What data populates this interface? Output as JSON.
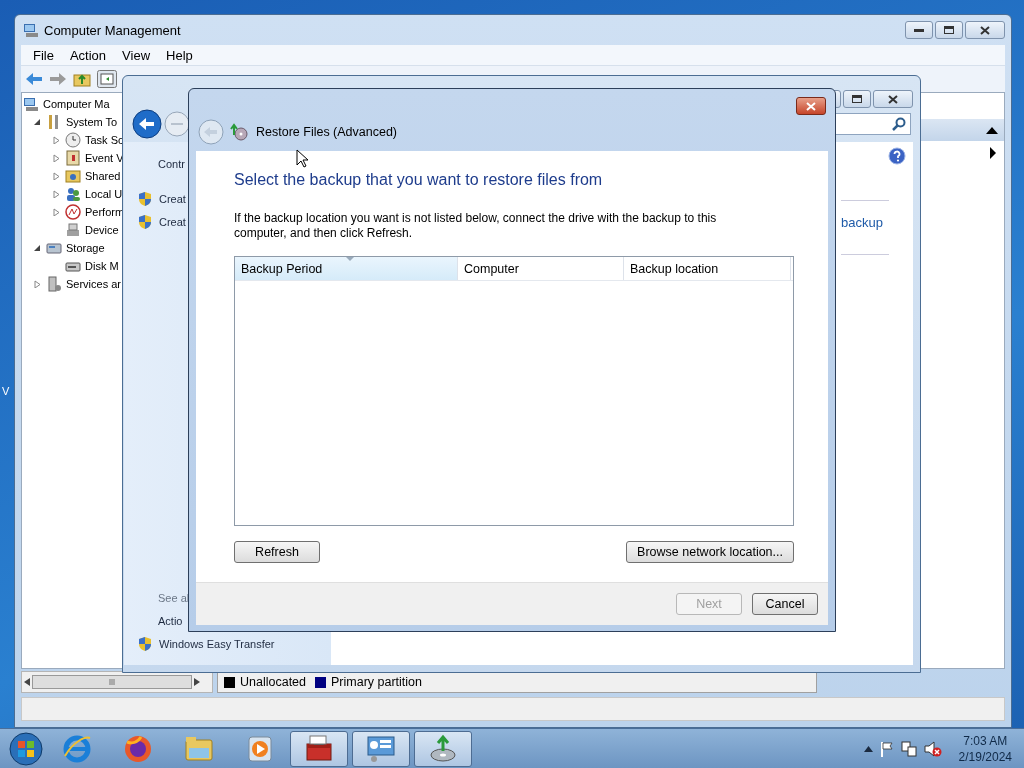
{
  "desktop": {
    "icon_label": "V"
  },
  "main_window": {
    "title": "Computer Management",
    "menu": [
      "File",
      "Action",
      "View",
      "Help"
    ],
    "tree": [
      {
        "label": "Computer Ma",
        "kind": "computer",
        "children": [
          {
            "label": "System To",
            "kind": "tools",
            "expanded": true,
            "children": [
              {
                "label": "Task Sc",
                "kind": "clock",
                "expanded": false
              },
              {
                "label": "Event V",
                "kind": "event",
                "expanded": false
              },
              {
                "label": "Shared",
                "kind": "shared",
                "expanded": false
              },
              {
                "label": "Local U",
                "kind": "users",
                "expanded": false
              },
              {
                "label": "Perform",
                "kind": "perf",
                "expanded": false
              },
              {
                "label": "Device",
                "kind": "device"
              }
            ]
          },
          {
            "label": "Storage",
            "kind": "storage",
            "expanded": true,
            "children": [
              {
                "label": "Disk M",
                "kind": "disk"
              }
            ]
          },
          {
            "label": "Services ar",
            "kind": "services",
            "expanded": false
          }
        ]
      }
    ],
    "legend": [
      {
        "label": "Unallocated",
        "color": "#000000"
      },
      {
        "label": "Primary partition",
        "color": "#000080"
      }
    ]
  },
  "backup_window": {
    "sidebar_top": [
      {
        "label": "Contr",
        "kind": "link"
      },
      {
        "label": "Creat",
        "kind": "shield"
      },
      {
        "label": "Creat",
        "kind": "shield"
      }
    ],
    "sidebar_bottom": [
      {
        "label": "See al",
        "kind": "heading"
      },
      {
        "label": "Actio",
        "kind": "link"
      },
      {
        "label": "Windows Easy Transfer",
        "kind": "shield"
      }
    ],
    "links": [
      "backup"
    ]
  },
  "dialog": {
    "title": "Restore Files (Advanced)",
    "heading": "Select the backup that you want to restore files from",
    "instructions": "If the backup location you want is not listed below, connect the drive with the backup to this computer, and then click Refresh.",
    "columns": [
      {
        "label": "Backup Period",
        "sorted": true
      },
      {
        "label": "Computer",
        "sorted": false
      },
      {
        "label": "Backup location",
        "sorted": false
      }
    ],
    "actions": [
      "Refresh",
      "Browse network location..."
    ],
    "footer_buttons": [
      {
        "label": "Next",
        "disabled": true
      },
      {
        "label": "Cancel",
        "disabled": false
      }
    ]
  },
  "taskbar": {
    "time": "7:03 AM",
    "date": "2/19/2024"
  }
}
